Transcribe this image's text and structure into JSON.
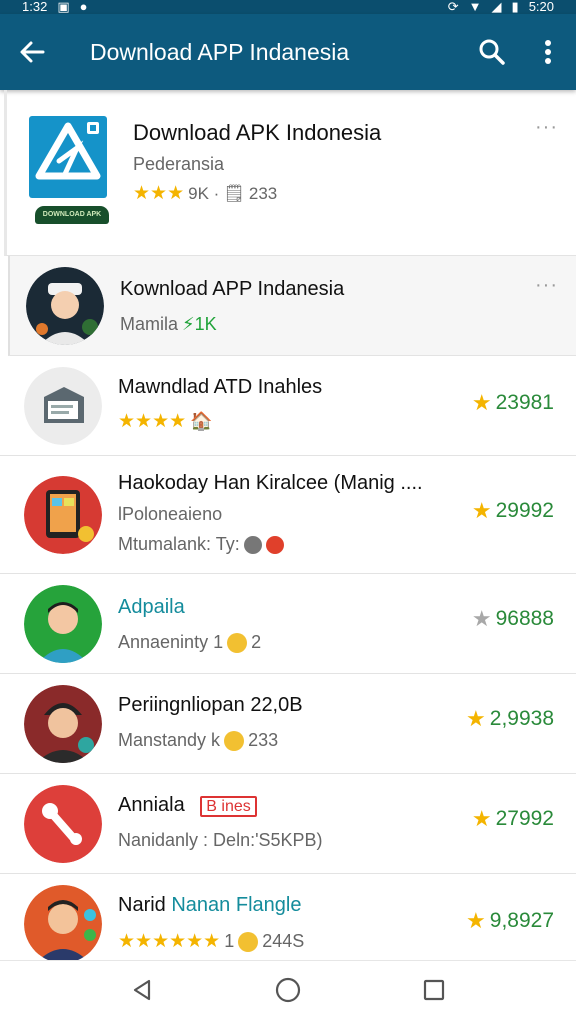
{
  "status_bar": {
    "time": "1:32",
    "clock": "5:20"
  },
  "app_bar": {
    "title": "Download APP Indanesia"
  },
  "header": {
    "title": "Download APK Indonesia",
    "subtitle": "Pederansia",
    "stars": "★★★",
    "downloads": "9K ·",
    "reviews": "233",
    "banner_text": "DOWNLOAD APK"
  },
  "items": [
    {
      "title": "Kownload APP Indanesia",
      "sub_prefix": "Mamila",
      "sub_accent": "⚡1K"
    },
    {
      "title": "Mawndlad ATD Inahles",
      "stars": "★★★★",
      "rating": "23981"
    },
    {
      "title": "Haokoday Han Kiralcee (Manig ....",
      "sub1": "lPoloneaieno",
      "sub2": "Mtumalank: Ty:",
      "rating": "29992"
    },
    {
      "title": "Adpaila",
      "sub": "Annaeninty 1",
      "sub_suffix": "2",
      "rating": "96888"
    },
    {
      "title": "Periingnliopan 22,0B",
      "sub": "Manstandy k",
      "sub_suffix": "233",
      "rating": "2,9938"
    },
    {
      "title": "Anniala",
      "badge": "B ines",
      "sub": "Nanidanly : Deln:'S5KPB)",
      "rating": "27992"
    },
    {
      "title_a": "Narid",
      "title_b": "Nanan Flangle",
      "stars": "★★★★★★",
      "sub": "1",
      "sub_suffix": "244S",
      "rating": "9,8927"
    }
  ],
  "more_label": "···",
  "colors": {
    "app_bar": "#0d5a7e",
    "rating": "#2a8a3a",
    "star": "#f4b400"
  }
}
